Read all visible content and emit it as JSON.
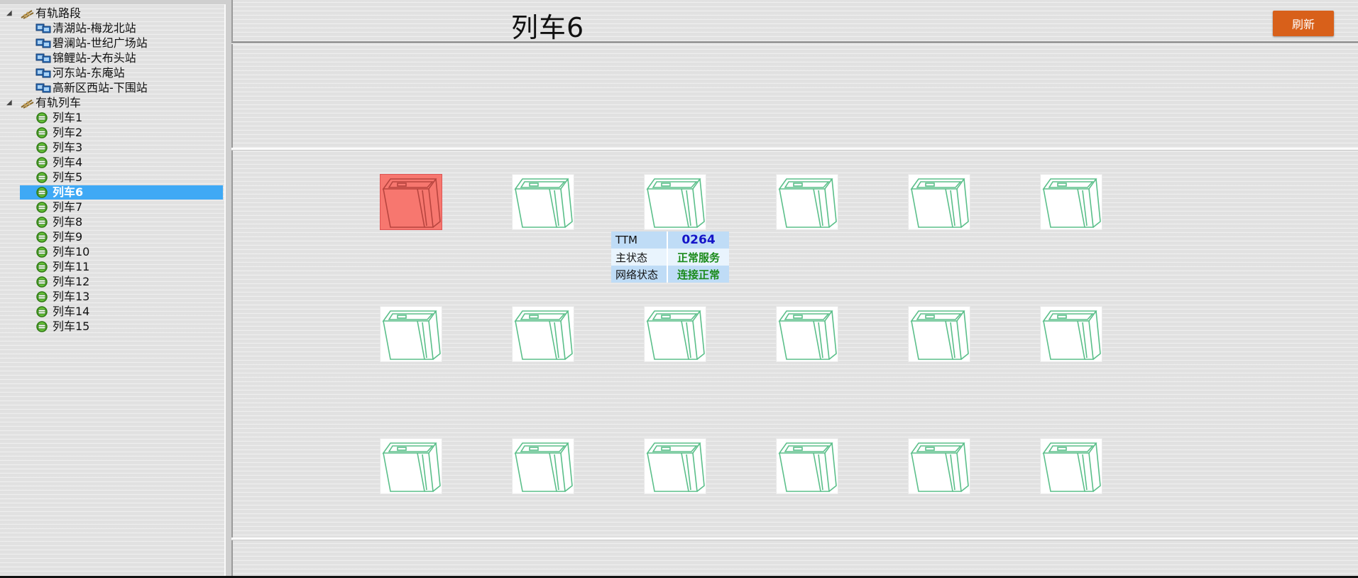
{
  "sidebar": {
    "groups": [
      {
        "label": "有轨路段",
        "icon": "track-segment-icon",
        "items": [
          {
            "label": "清湖站-梅龙北站",
            "icon": "station-icon"
          },
          {
            "label": "碧澜站-世纪广场站",
            "icon": "station-icon"
          },
          {
            "label": "锦鲤站-大布头站",
            "icon": "station-icon"
          },
          {
            "label": "河东站-东庵站",
            "icon": "station-icon"
          },
          {
            "label": "高新区西站-下围站",
            "icon": "station-icon"
          }
        ]
      },
      {
        "label": "有轨列车",
        "icon": "tram-group-icon",
        "items": [
          {
            "label": "列车1",
            "icon": "train-icon"
          },
          {
            "label": "列车2",
            "icon": "train-icon"
          },
          {
            "label": "列车3",
            "icon": "train-icon"
          },
          {
            "label": "列车4",
            "icon": "train-icon"
          },
          {
            "label": "列车5",
            "icon": "train-icon"
          },
          {
            "label": "列车6",
            "icon": "train-icon",
            "selected": true
          },
          {
            "label": "列车7",
            "icon": "train-icon"
          },
          {
            "label": "列车8",
            "icon": "train-icon"
          },
          {
            "label": "列车9",
            "icon": "train-icon"
          },
          {
            "label": "列车10",
            "icon": "train-icon"
          },
          {
            "label": "列车11",
            "icon": "train-icon"
          },
          {
            "label": "列车12",
            "icon": "train-icon"
          },
          {
            "label": "列车13",
            "icon": "train-icon"
          },
          {
            "label": "列车14",
            "icon": "train-icon"
          },
          {
            "label": "列车15",
            "icon": "train-icon"
          }
        ]
      }
    ]
  },
  "header": {
    "title": "列车6",
    "refresh_label": "刷新"
  },
  "terminals": {
    "rows": 3,
    "cols": 6,
    "active_index": 0,
    "active_color": "#f7776f",
    "normal_color": "#5bbf8a"
  },
  "info": {
    "rows": [
      {
        "key": "TTM",
        "value": "0264",
        "value_color": "#1414c8"
      },
      {
        "key": "主状态",
        "value": "正常服务",
        "value_color": "#1a8a1a"
      },
      {
        "key": "网络状态",
        "value": "连接正常",
        "value_color": "#1a8a1a"
      }
    ]
  }
}
